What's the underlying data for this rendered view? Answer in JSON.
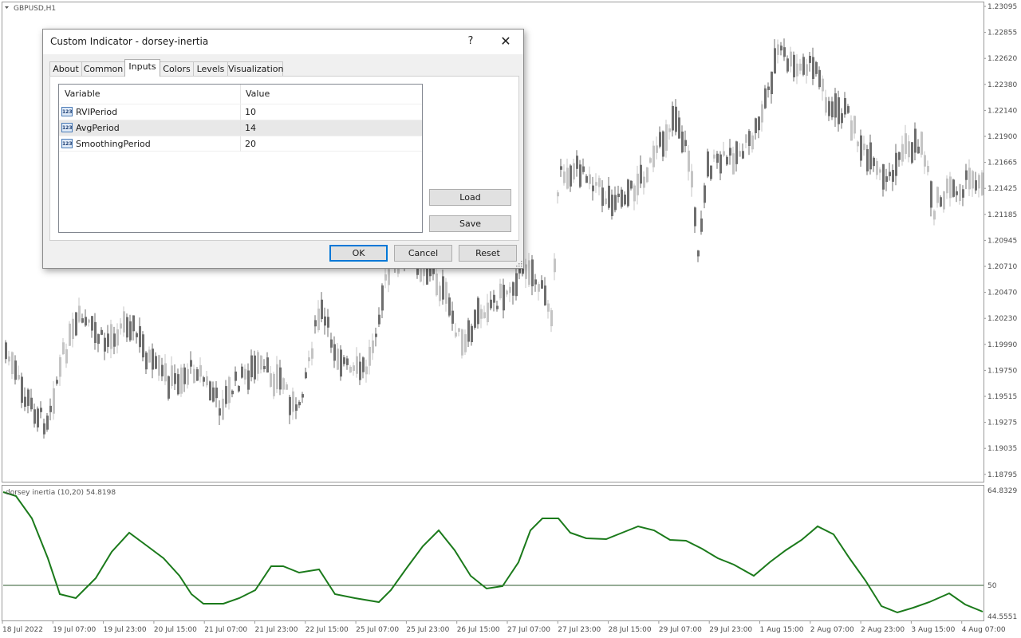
{
  "chart": {
    "symbol_label": "GBPUSD,H1",
    "price_levels": [
      "1.23095",
      "1.22855",
      "1.22620",
      "1.22380",
      "1.22140",
      "1.21900",
      "1.21665",
      "1.21425",
      "1.21185",
      "1.20945",
      "1.20710",
      "1.20470",
      "1.20230",
      "1.19990",
      "1.19750",
      "1.19515",
      "1.19275",
      "1.19035",
      "1.18795"
    ],
    "time_labels": [
      "18 Jul 2022",
      "19 Jul 07:00",
      "19 Jul 23:00",
      "20 Jul 15:00",
      "21 Jul 07:00",
      "21 Jul 23:00",
      "22 Jul 15:00",
      "25 Jul 07:00",
      "25 Jul 23:00",
      "26 Jul 15:00",
      "27 Jul 07:00",
      "27 Jul 23:00",
      "28 Jul 15:00",
      "29 Jul 07:00",
      "29 Jul 23:00",
      "1 Aug 15:00",
      "2 Aug 07:00",
      "2 Aug 23:00",
      "3 Aug 15:00",
      "4 Aug 07:00"
    ],
    "up_color": "#c4c4c4",
    "down_color": "#6e6e6e"
  },
  "indicator": {
    "label": "dorsey inertia (10,20) 54.8198",
    "levels": [
      "64.8329",
      "50",
      "44.5551"
    ],
    "line_color": "#1b7a1b",
    "level_line_color": "#2e5a2e"
  },
  "dialog": {
    "title": "Custom Indicator - dorsey-inertia",
    "help_label": "?",
    "close_label": "✕",
    "tabs": [
      {
        "label": "About"
      },
      {
        "label": "Common"
      },
      {
        "label": "Inputs"
      },
      {
        "label": "Colors"
      },
      {
        "label": "Levels"
      },
      {
        "label": "Visualization"
      }
    ],
    "active_tab": "Inputs",
    "grid": {
      "col_variable": "Variable",
      "col_value": "Value",
      "rows": [
        {
          "icon": "123",
          "name": "RVIPeriod",
          "value": "10"
        },
        {
          "icon": "123",
          "name": "AvgPeriod",
          "value": "14"
        },
        {
          "icon": "123",
          "name": "SmoothingPeriod",
          "value": "20"
        }
      ]
    },
    "load_label": "Load",
    "save_label": "Save",
    "ok_label": "OK",
    "cancel_label": "Cancel",
    "reset_label": "Reset"
  }
}
